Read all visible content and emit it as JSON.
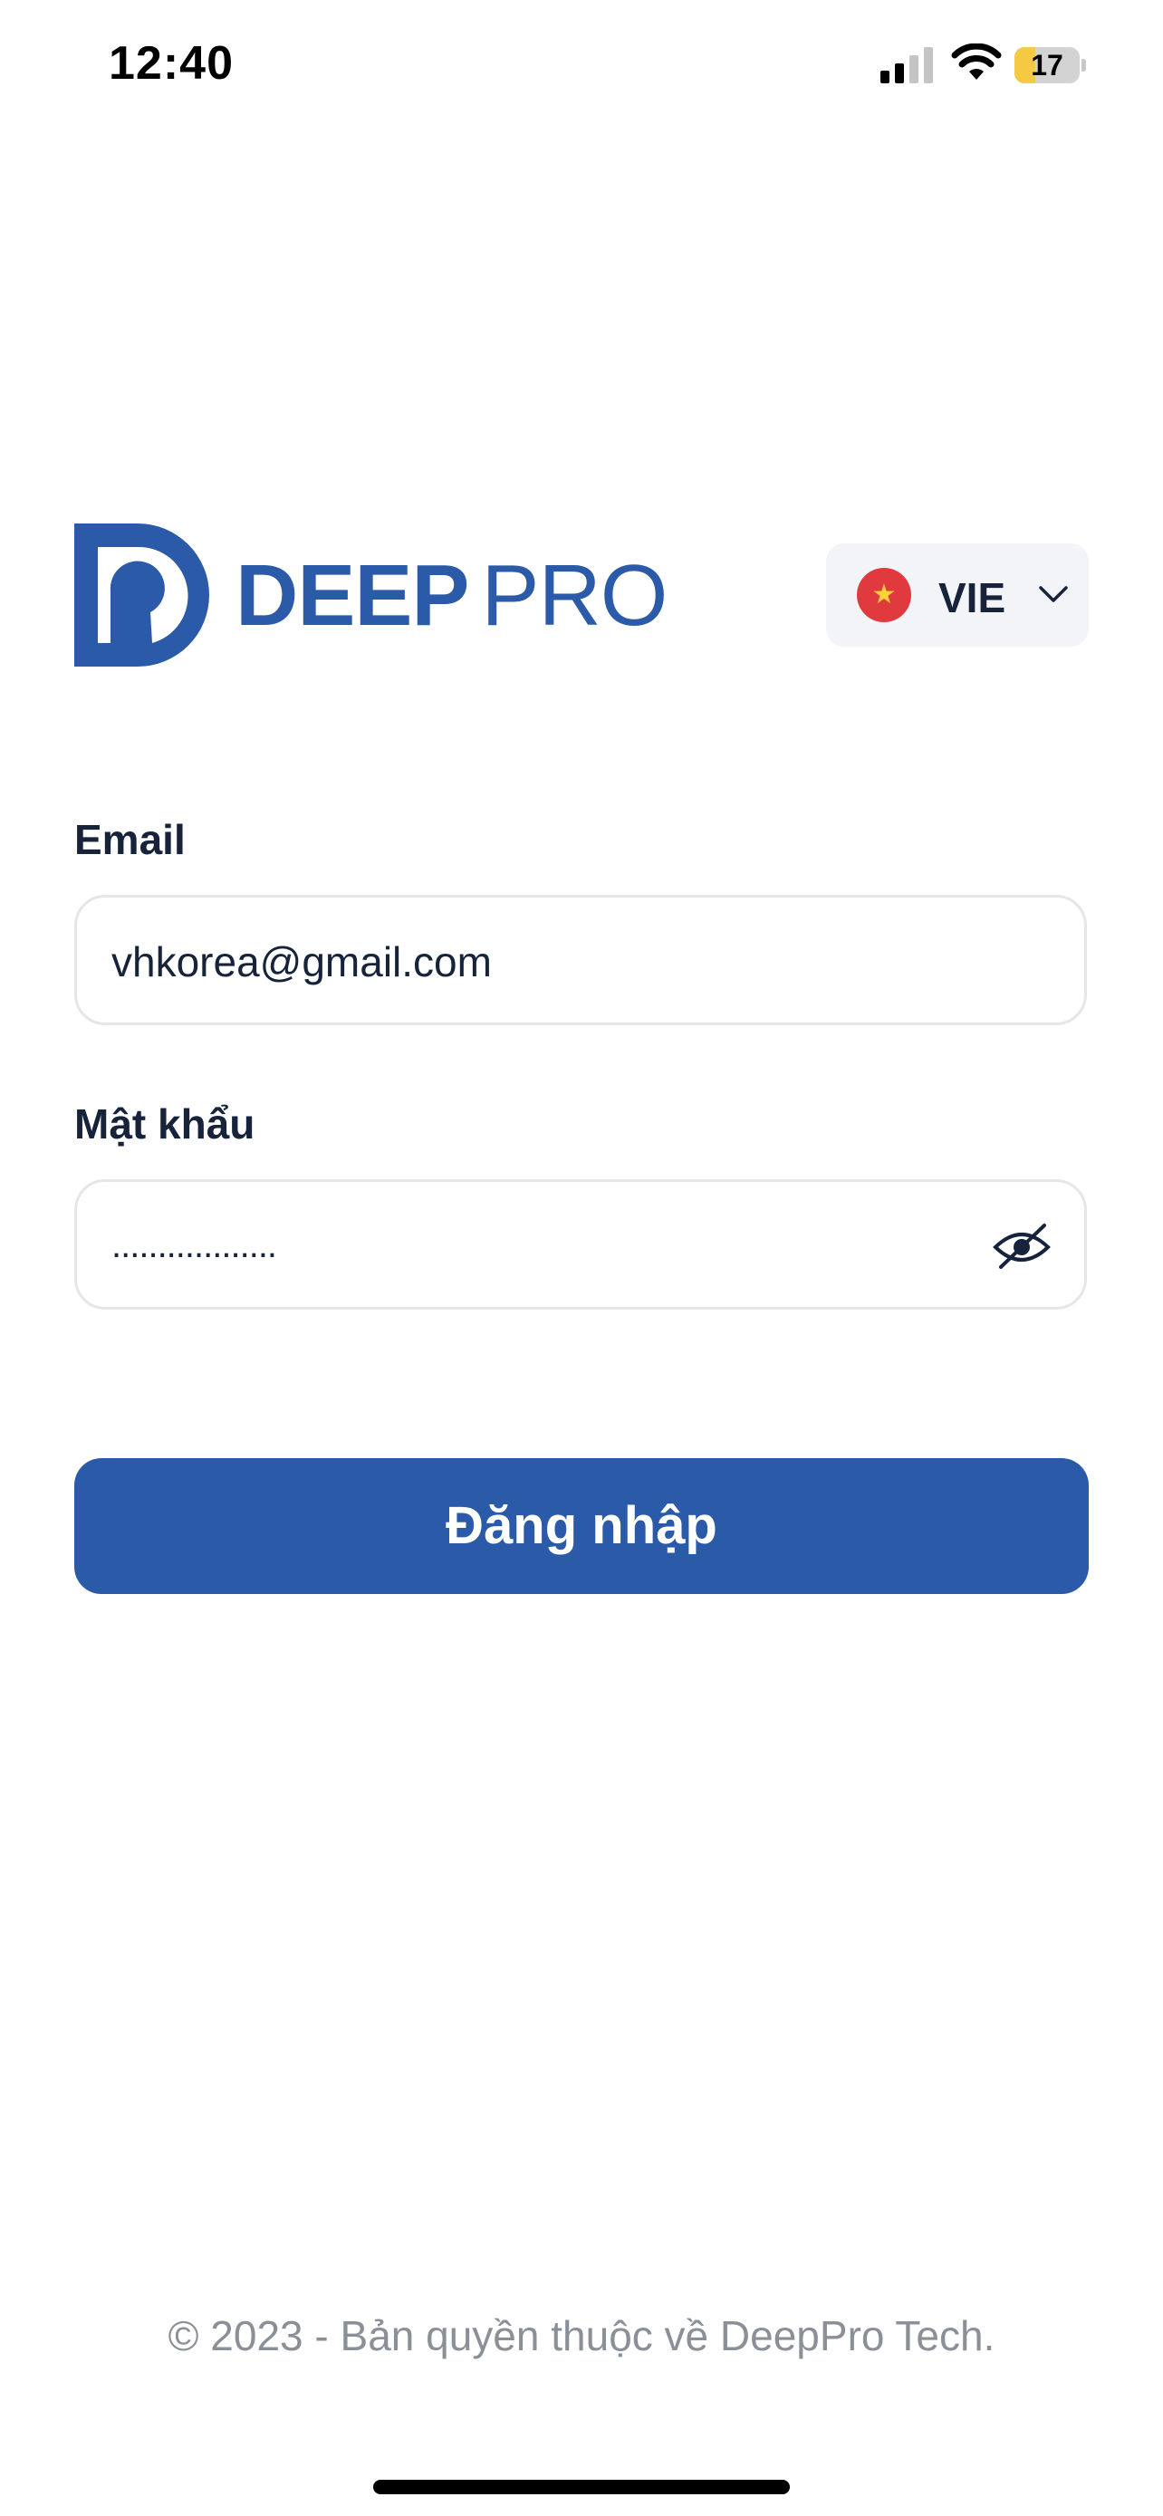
{
  "status_bar": {
    "time": "12:40",
    "battery_level": "17",
    "battery_fraction": 0.17,
    "icons": [
      "cellular-signal-icon",
      "wifi-icon",
      "battery-icon"
    ]
  },
  "logo": {
    "word_bold": "DEEP",
    "word_light": "PRO",
    "brand_color": "#2a5aa8"
  },
  "language": {
    "code": "VIE",
    "flag": "vietnam-flag-icon"
  },
  "form": {
    "email_label": "Email",
    "email_value": "vhkorea@gmail.com",
    "password_label": "Mật khẩu",
    "password_masked": "..................",
    "login_button": "Đăng nhập"
  },
  "footer": {
    "copyright": "© 2023 - Bản quyền thuộc về DeepPro Tech."
  },
  "colors": {
    "primary": "#2a5aa8",
    "text": "#16233a",
    "muted": "#8a8f98",
    "input_border": "#e4e6ea",
    "selector_bg": "#f3f4f8"
  }
}
